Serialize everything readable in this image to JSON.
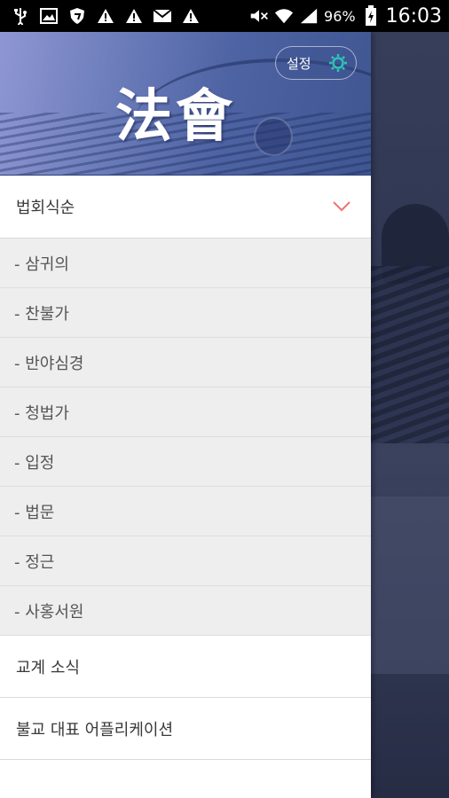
{
  "status_bar": {
    "icons_left": [
      "usb-icon",
      "image-icon",
      "shield-icon",
      "warning-icon",
      "warning-icon",
      "mail-icon",
      "warning-icon"
    ],
    "battery": "96%",
    "time": "16:03"
  },
  "drawer": {
    "header_title": "法會",
    "settings_label": "설정",
    "section": {
      "label": "법회식순",
      "expanded": true
    },
    "sub_items": [
      "- 삼귀의",
      "- 찬불가",
      "- 반야심경",
      "- 청법가",
      "- 입정",
      "- 법문",
      "- 정근",
      "- 사홍서원"
    ],
    "menu_items": [
      "교계 소식",
      "불교 대표 어플리케이션"
    ]
  },
  "colors": {
    "accent_gear": "#2ec4b6",
    "chevron": "#f07070",
    "sub_bg": "#eeeeee"
  }
}
